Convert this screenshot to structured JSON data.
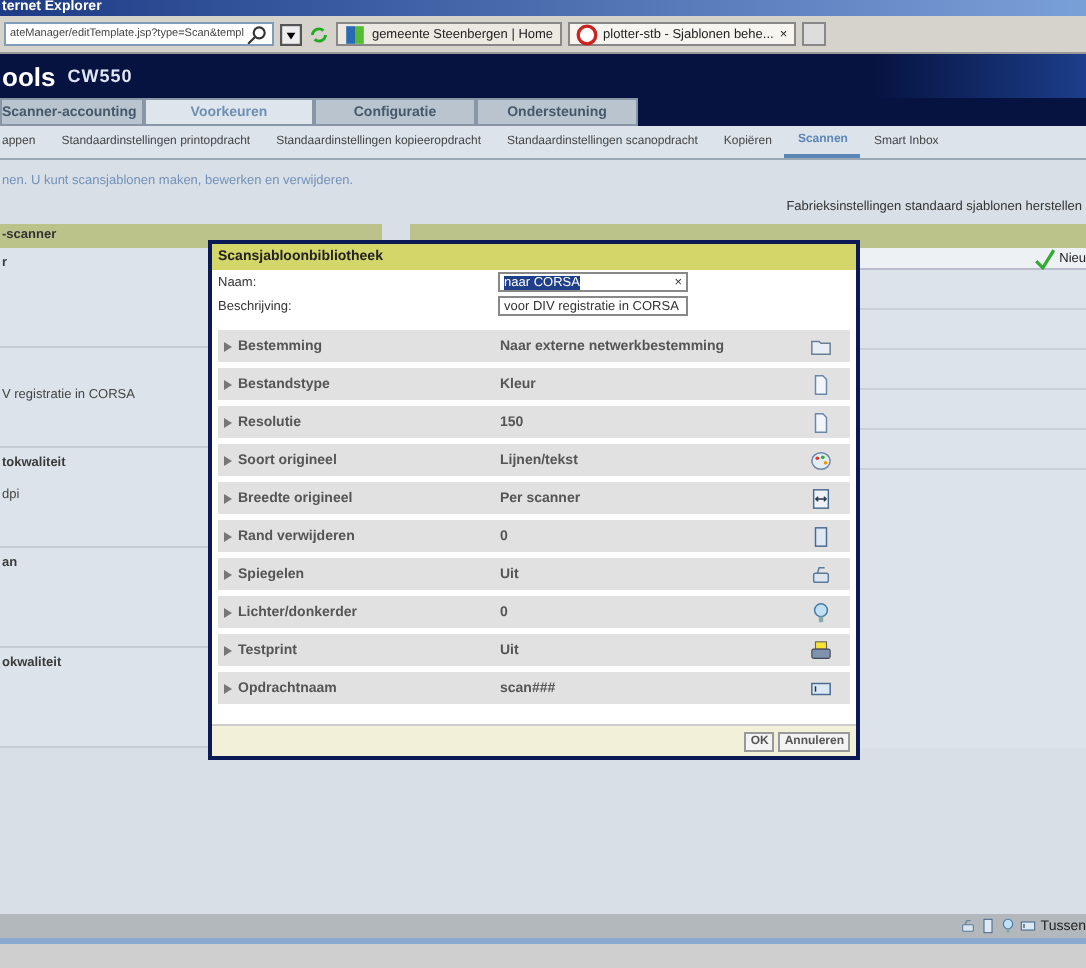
{
  "window": {
    "title": "ternet Explorer"
  },
  "browser": {
    "address": "ateManager/editTemplate.jsp?type=Scan&templ",
    "tabs": [
      {
        "label": "gemeente Steenbergen | Home",
        "selected": false
      },
      {
        "label": "plotter-stb - Sjablonen behe...",
        "selected": true
      }
    ],
    "close_tab": "×"
  },
  "header": {
    "product": "ools",
    "model": "CW550"
  },
  "main_tabs": [
    {
      "label": "Scanner-accounting",
      "selected": false
    },
    {
      "label": "Voorkeuren",
      "selected": true
    },
    {
      "label": "Configuratie",
      "selected": false
    },
    {
      "label": "Ondersteuning",
      "selected": false
    }
  ],
  "sub_tabs": [
    {
      "label": "appen",
      "selected": false
    },
    {
      "label": "Standaardinstellingen printopdracht",
      "selected": false
    },
    {
      "label": "Standaardinstellingen kopieeropdracht",
      "selected": false
    },
    {
      "label": "Standaardinstellingen scanopdracht",
      "selected": false
    },
    {
      "label": "Kopiëren",
      "selected": false
    },
    {
      "label": "Scannen",
      "selected": true
    },
    {
      "label": "Smart Inbox",
      "selected": false
    }
  ],
  "intro": "nen. U kunt scansjablonen maken, bewerken en verwijderen.",
  "restore_link": "Fabrieksinstellingen standaard sjablonen herstellen",
  "left_panel": {
    "title": "-scanner",
    "items": [
      {
        "title": "r"
      },
      {
        "text": "V registratie in CORSA"
      },
      {
        "title": "tokwaliteit",
        "text": "dpi"
      },
      {
        "title": "an"
      },
      {
        "title": "okwaliteit"
      }
    ]
  },
  "right_panel": {
    "new_button": "Nieu"
  },
  "dialog": {
    "title": "Scansjabloonbibliotheek",
    "fields": [
      {
        "label": "Naam:",
        "value": "naar CORSA",
        "highlighted": true,
        "clear": "×"
      },
      {
        "label": "Beschrijving:",
        "value": "voor DIV registratie in CORSA",
        "highlighted": false
      }
    ],
    "settings": [
      {
        "label": "Bestemming",
        "value": "Naar externe netwerkbestemming",
        "kind": "destination"
      },
      {
        "label": "Bestandstype",
        "value": "Kleur",
        "kind": "filetype"
      },
      {
        "label": "Resolutie",
        "value": "150",
        "kind": "resolution"
      },
      {
        "label": "Soort origineel",
        "value": "Lijnen/tekst",
        "kind": "original"
      },
      {
        "label": "Breedte origineel",
        "value": "Per scanner",
        "kind": "width"
      },
      {
        "label": "Rand verwijderen",
        "value": "0",
        "kind": "edge"
      },
      {
        "label": "Spiegelen",
        "value": "Uit",
        "kind": "mirror"
      },
      {
        "label": "Lichter/donkerder",
        "value": "0",
        "kind": "lightness"
      },
      {
        "label": "Testprint",
        "value": "Uit",
        "kind": "testprint"
      },
      {
        "label": "Opdrachtnaam",
        "value": "scan###",
        "kind": "jobname"
      }
    ],
    "buttons": [
      "OK",
      "Annuleren"
    ]
  },
  "status_bar": {
    "text": "Tussen"
  }
}
